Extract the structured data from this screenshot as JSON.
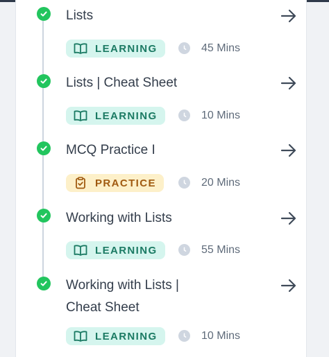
{
  "colors": {
    "complete": "#22c55e",
    "learning_bg": "#d5f5ee",
    "learning_text": "#1b7a63",
    "practice_bg": "#fdf0c9",
    "practice_text": "#a05a10",
    "title_text": "#333d4b"
  },
  "items": [
    {
      "title": "Lists",
      "badge": "LEARNING",
      "badge_icon": "book-icon",
      "duration": "45 Mins",
      "status": "completed"
    },
    {
      "title": "Lists | Cheat Sheet",
      "badge": "LEARNING",
      "badge_icon": "book-icon",
      "duration": "10 Mins",
      "status": "completed"
    },
    {
      "title": "MCQ Practice I",
      "badge": "PRACTICE",
      "badge_icon": "clipboard-check-icon",
      "duration": "20 Mins",
      "status": "completed"
    },
    {
      "title": "Working with Lists",
      "badge": "LEARNING",
      "badge_icon": "book-icon",
      "duration": "55 Mins",
      "status": "completed"
    },
    {
      "title_line1": "Working with Lists |",
      "title_line2": "Cheat Sheet",
      "badge": "LEARNING",
      "badge_icon": "book-icon",
      "duration": "10 Mins",
      "status": "completed"
    }
  ]
}
